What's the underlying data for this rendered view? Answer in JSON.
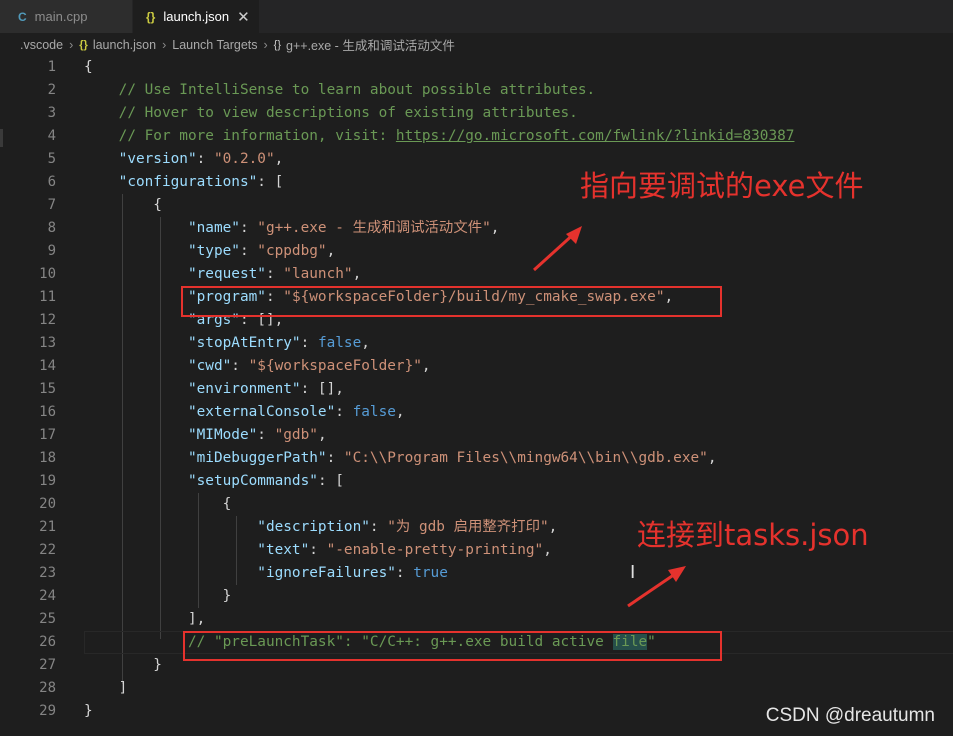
{
  "tabs": [
    {
      "icon": "C",
      "label": "main.cpp"
    },
    {
      "icon": "{}",
      "label": "launch.json",
      "close": "✕"
    }
  ],
  "breadcrumb": {
    "vscode": ".vscode",
    "file_icon": "{}",
    "file": "launch.json",
    "launch_targets": "Launch Targets",
    "obj_icon": "{}",
    "target": "g++.exe - 生成和调试活动文件"
  },
  "lines": [
    {
      "n": "1",
      "t": [
        [
          "p",
          "{"
        ]
      ]
    },
    {
      "n": "2",
      "t": [
        [
          "p",
          "    "
        ],
        [
          "c",
          "// Use IntelliSense to learn about possible attributes."
        ]
      ]
    },
    {
      "n": "3",
      "t": [
        [
          "p",
          "    "
        ],
        [
          "c",
          "// Hover to view descriptions of existing attributes."
        ]
      ]
    },
    {
      "n": "4",
      "t": [
        [
          "p",
          "    "
        ],
        [
          "c",
          "// For more information, visit: "
        ],
        [
          "cu",
          "https://go.microsoft.com/fwlink/?linkid=830387"
        ]
      ]
    },
    {
      "n": "5",
      "t": [
        [
          "p",
          "    "
        ],
        [
          "k",
          "\"version\""
        ],
        [
          "p",
          ": "
        ],
        [
          "s",
          "\"0.2.0\""
        ],
        [
          "p",
          ","
        ]
      ]
    },
    {
      "n": "6",
      "t": [
        [
          "p",
          "    "
        ],
        [
          "k",
          "\"configurations\""
        ],
        [
          "p",
          ": ["
        ]
      ]
    },
    {
      "n": "7",
      "t": [
        [
          "p",
          "        {"
        ]
      ]
    },
    {
      "n": "8",
      "t": [
        [
          "p",
          "            "
        ],
        [
          "k",
          "\"name\""
        ],
        [
          "p",
          ": "
        ],
        [
          "s",
          "\"g++.exe - 生成和调试活动文件\""
        ],
        [
          "p",
          ","
        ]
      ]
    },
    {
      "n": "9",
      "t": [
        [
          "p",
          "            "
        ],
        [
          "k",
          "\"type\""
        ],
        [
          "p",
          ": "
        ],
        [
          "s",
          "\"cppdbg\""
        ],
        [
          "p",
          ","
        ]
      ]
    },
    {
      "n": "10",
      "t": [
        [
          "p",
          "            "
        ],
        [
          "k",
          "\"request\""
        ],
        [
          "p",
          ": "
        ],
        [
          "s",
          "\"launch\""
        ],
        [
          "p",
          ","
        ]
      ]
    },
    {
      "n": "11",
      "t": [
        [
          "p",
          "            "
        ],
        [
          "k",
          "\"program\""
        ],
        [
          "p",
          ": "
        ],
        [
          "s",
          "\"${workspaceFolder}/build/my_cmake_swap.exe\""
        ],
        [
          "p",
          ","
        ]
      ]
    },
    {
      "n": "12",
      "t": [
        [
          "p",
          "            "
        ],
        [
          "k",
          "\"args\""
        ],
        [
          "p",
          ": [],"
        ]
      ]
    },
    {
      "n": "13",
      "t": [
        [
          "p",
          "            "
        ],
        [
          "k",
          "\"stopAtEntry\""
        ],
        [
          "p",
          ": "
        ],
        [
          "b",
          "false"
        ],
        [
          "p",
          ","
        ]
      ]
    },
    {
      "n": "14",
      "t": [
        [
          "p",
          "            "
        ],
        [
          "k",
          "\"cwd\""
        ],
        [
          "p",
          ": "
        ],
        [
          "s",
          "\"${workspaceFolder}\""
        ],
        [
          "p",
          ","
        ]
      ]
    },
    {
      "n": "15",
      "t": [
        [
          "p",
          "            "
        ],
        [
          "k",
          "\"environment\""
        ],
        [
          "p",
          ": [],"
        ]
      ]
    },
    {
      "n": "16",
      "t": [
        [
          "p",
          "            "
        ],
        [
          "k",
          "\"externalConsole\""
        ],
        [
          "p",
          ": "
        ],
        [
          "b",
          "false"
        ],
        [
          "p",
          ","
        ]
      ]
    },
    {
      "n": "17",
      "t": [
        [
          "p",
          "            "
        ],
        [
          "k",
          "\"MIMode\""
        ],
        [
          "p",
          ": "
        ],
        [
          "s",
          "\"gdb\""
        ],
        [
          "p",
          ","
        ]
      ]
    },
    {
      "n": "18",
      "t": [
        [
          "p",
          "            "
        ],
        [
          "k",
          "\"miDebuggerPath\""
        ],
        [
          "p",
          ": "
        ],
        [
          "s",
          "\"C:\\\\Program Files\\\\mingw64\\\\bin\\\\gdb.exe\""
        ],
        [
          "p",
          ","
        ]
      ]
    },
    {
      "n": "19",
      "t": [
        [
          "p",
          "            "
        ],
        [
          "k",
          "\"setupCommands\""
        ],
        [
          "p",
          ": ["
        ]
      ]
    },
    {
      "n": "20",
      "t": [
        [
          "p",
          "                {"
        ]
      ]
    },
    {
      "n": "21",
      "t": [
        [
          "p",
          "                    "
        ],
        [
          "k",
          "\"description\""
        ],
        [
          "p",
          ": "
        ],
        [
          "s",
          "\"为 gdb 启用整齐打印\""
        ],
        [
          "p",
          ","
        ]
      ]
    },
    {
      "n": "22",
      "t": [
        [
          "p",
          "                    "
        ],
        [
          "k",
          "\"text\""
        ],
        [
          "p",
          ": "
        ],
        [
          "s",
          "\"-enable-pretty-printing\""
        ],
        [
          "p",
          ","
        ]
      ]
    },
    {
      "n": "23",
      "t": [
        [
          "p",
          "                    "
        ],
        [
          "k",
          "\"ignoreFailures\""
        ],
        [
          "p",
          ": "
        ],
        [
          "b",
          "true"
        ]
      ]
    },
    {
      "n": "24",
      "t": [
        [
          "p",
          "                }"
        ]
      ]
    },
    {
      "n": "25",
      "t": [
        [
          "p",
          "            ],"
        ]
      ]
    },
    {
      "n": "26",
      "t": [
        [
          "p",
          "            "
        ],
        [
          "c",
          "// \"preLaunchTask\": \"C/C++: g++.exe build active "
        ],
        [
          "ch",
          "file"
        ],
        [
          "c",
          "\""
        ]
      ]
    },
    {
      "n": "27",
      "t": [
        [
          "p",
          "        }"
        ]
      ]
    },
    {
      "n": "28",
      "t": [
        [
          "p",
          "    ]"
        ]
      ]
    },
    {
      "n": "29",
      "t": [
        [
          "p",
          "}"
        ]
      ]
    }
  ],
  "annotations": {
    "exe_note": "指向要调试的exe文件",
    "tasks_note": "连接到tasks.json"
  },
  "watermark": "CSDN @dreautumn",
  "colors": {
    "annotation": "#e5322d",
    "key": "#9cdcfe",
    "string": "#ce9178",
    "comment": "#6a9955",
    "keyword": "#569cd6"
  }
}
